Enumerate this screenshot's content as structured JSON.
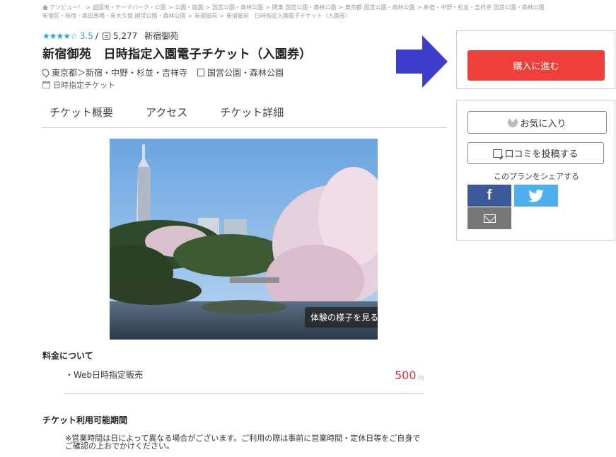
{
  "breadcrumb": {
    "line1": [
      "アソビュー！",
      "遊園地・テーマパーク・公園",
      "公園・庭園",
      "国営公園・森林公園",
      "関東 国営公園・森林公園",
      "東京都 国営公園・森林公園",
      "新宿・中野・杉並・吉祥寺 国営公園・森林公園"
    ],
    "line2": [
      "新宿区・新宿・高田馬場・新大久保 国営公園・森林公園",
      "新宿御苑",
      "新宿御苑　日時指定入園電子チケット（入園券）"
    ]
  },
  "rating": {
    "stars": "★★★★☆",
    "score": "3.5",
    "slash": "/",
    "reviews": "5,277",
    "area": "新宿御苑"
  },
  "title": "新宿御苑　日時指定入園電子チケット（入園券）",
  "meta": {
    "location": "東京都＞新宿・中野・杉並・吉祥寺",
    "category": "国営公園・森林公園",
    "ticket_type": "日時指定チケット"
  },
  "tabs": [
    "チケット概要",
    "アクセス",
    "チケット詳細"
  ],
  "photo": {
    "button_label": "体験の様子を見る"
  },
  "pricing": {
    "heading": "料金について",
    "item": "・Web日時指定販売",
    "price": "500",
    "unit": "円"
  },
  "availability": {
    "heading": "チケット利用可能期間",
    "notice": "※営業時間は日によって異なる場合がございます。ご利用の際は事前に営業時間・定休日等をご自身でご確認の上おでかけください。"
  },
  "sidebar": {
    "buy_label": "購入に進む",
    "favorite_label": "お気に入り",
    "review_label": "口コミを投稿する",
    "share_label": "このプランをシェアする",
    "facebook_glyph": "f"
  },
  "colors": {
    "buy": "#ee3f3a",
    "facebook": "#3b5999",
    "twitter": "#4db0ec",
    "mail": "#777777",
    "arrow": "#3d3fcc",
    "price": "#d9333f",
    "stars": "#24a8c8"
  }
}
